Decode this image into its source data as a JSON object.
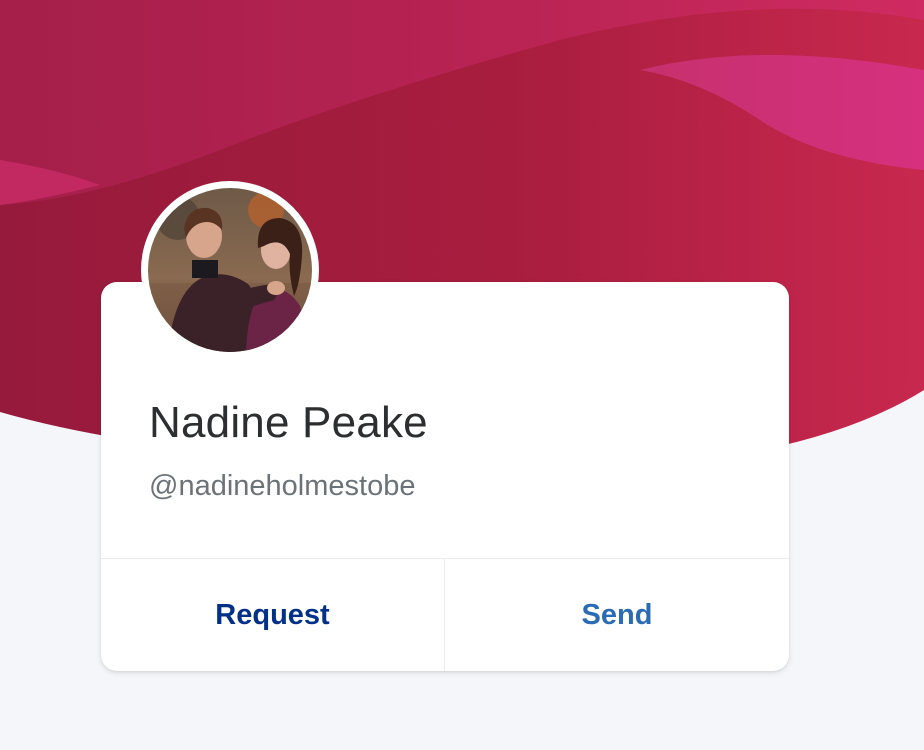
{
  "profile": {
    "name": "Nadine Peake",
    "handle": "@nadineholmestobe",
    "avatar_icon": "profile-photo"
  },
  "actions": {
    "request_label": "Request",
    "send_label": "Send"
  },
  "colors": {
    "header_primary": "#b0214a",
    "header_accent": "#d12f7c",
    "request_text": "#003087",
    "send_text": "#2a6cb3",
    "page_background": "#f5f6fa"
  }
}
